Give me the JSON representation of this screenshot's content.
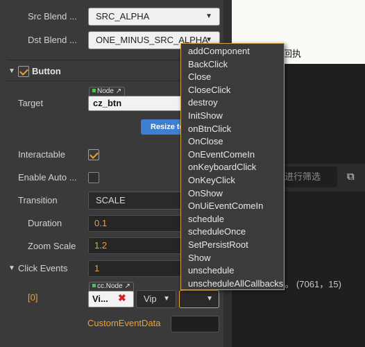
{
  "inspector": {
    "src_blend": {
      "label": "Src Blend ...",
      "value": "SRC_ALPHA"
    },
    "dst_blend": {
      "label": "Dst Blend ...",
      "value": "ONE_MINUS_SRC_ALPHA"
    },
    "button_section": {
      "title": "Button"
    },
    "target": {
      "label": "Target",
      "tag": "Node",
      "value": "cz_btn"
    },
    "resize_button": "Resize to Target",
    "interactable": {
      "label": "Interactable",
      "checked": true
    },
    "enable_auto": {
      "label": "Enable Auto ...",
      "checked": false
    },
    "transition": {
      "label": "Transition",
      "value": "SCALE"
    },
    "duration": {
      "label": "Duration",
      "value": "0.1"
    },
    "zoom_scale": {
      "label": "Zoom Scale",
      "value": "1.2"
    },
    "click_events": {
      "label": "Click Events",
      "value": "1"
    },
    "event0": {
      "index": "[0]",
      "tag": "cc.Node",
      "node_value": "Vi...",
      "component": "Vip",
      "handler": ""
    },
    "custom_event_data": {
      "label": "CustomEventData",
      "value": ""
    }
  },
  "dropdown_menu": [
    "addComponent",
    "BackClick",
    "Close",
    "CloseClick",
    "destroy",
    "InitShow",
    "onBtnClick",
    "OnClose",
    "OnEventComeIn",
    "onKeyboardClick",
    "OnKeyClick",
    "OnShow",
    "OnUiEventComeIn",
    "schedule",
    "scheduleOnce",
    "SetPersistRoot",
    "Show",
    "unschedule",
    "unscheduleAllCallbacks"
  ],
  "right_panel": {
    "top_text": "回执",
    "filter_placeholder": "进行筛选",
    "log_text": "”。 (7061，15)"
  },
  "colors": {
    "accent": "#f0a030",
    "menu_border": "#d4a640",
    "resize_button": "#3d7fd0"
  }
}
